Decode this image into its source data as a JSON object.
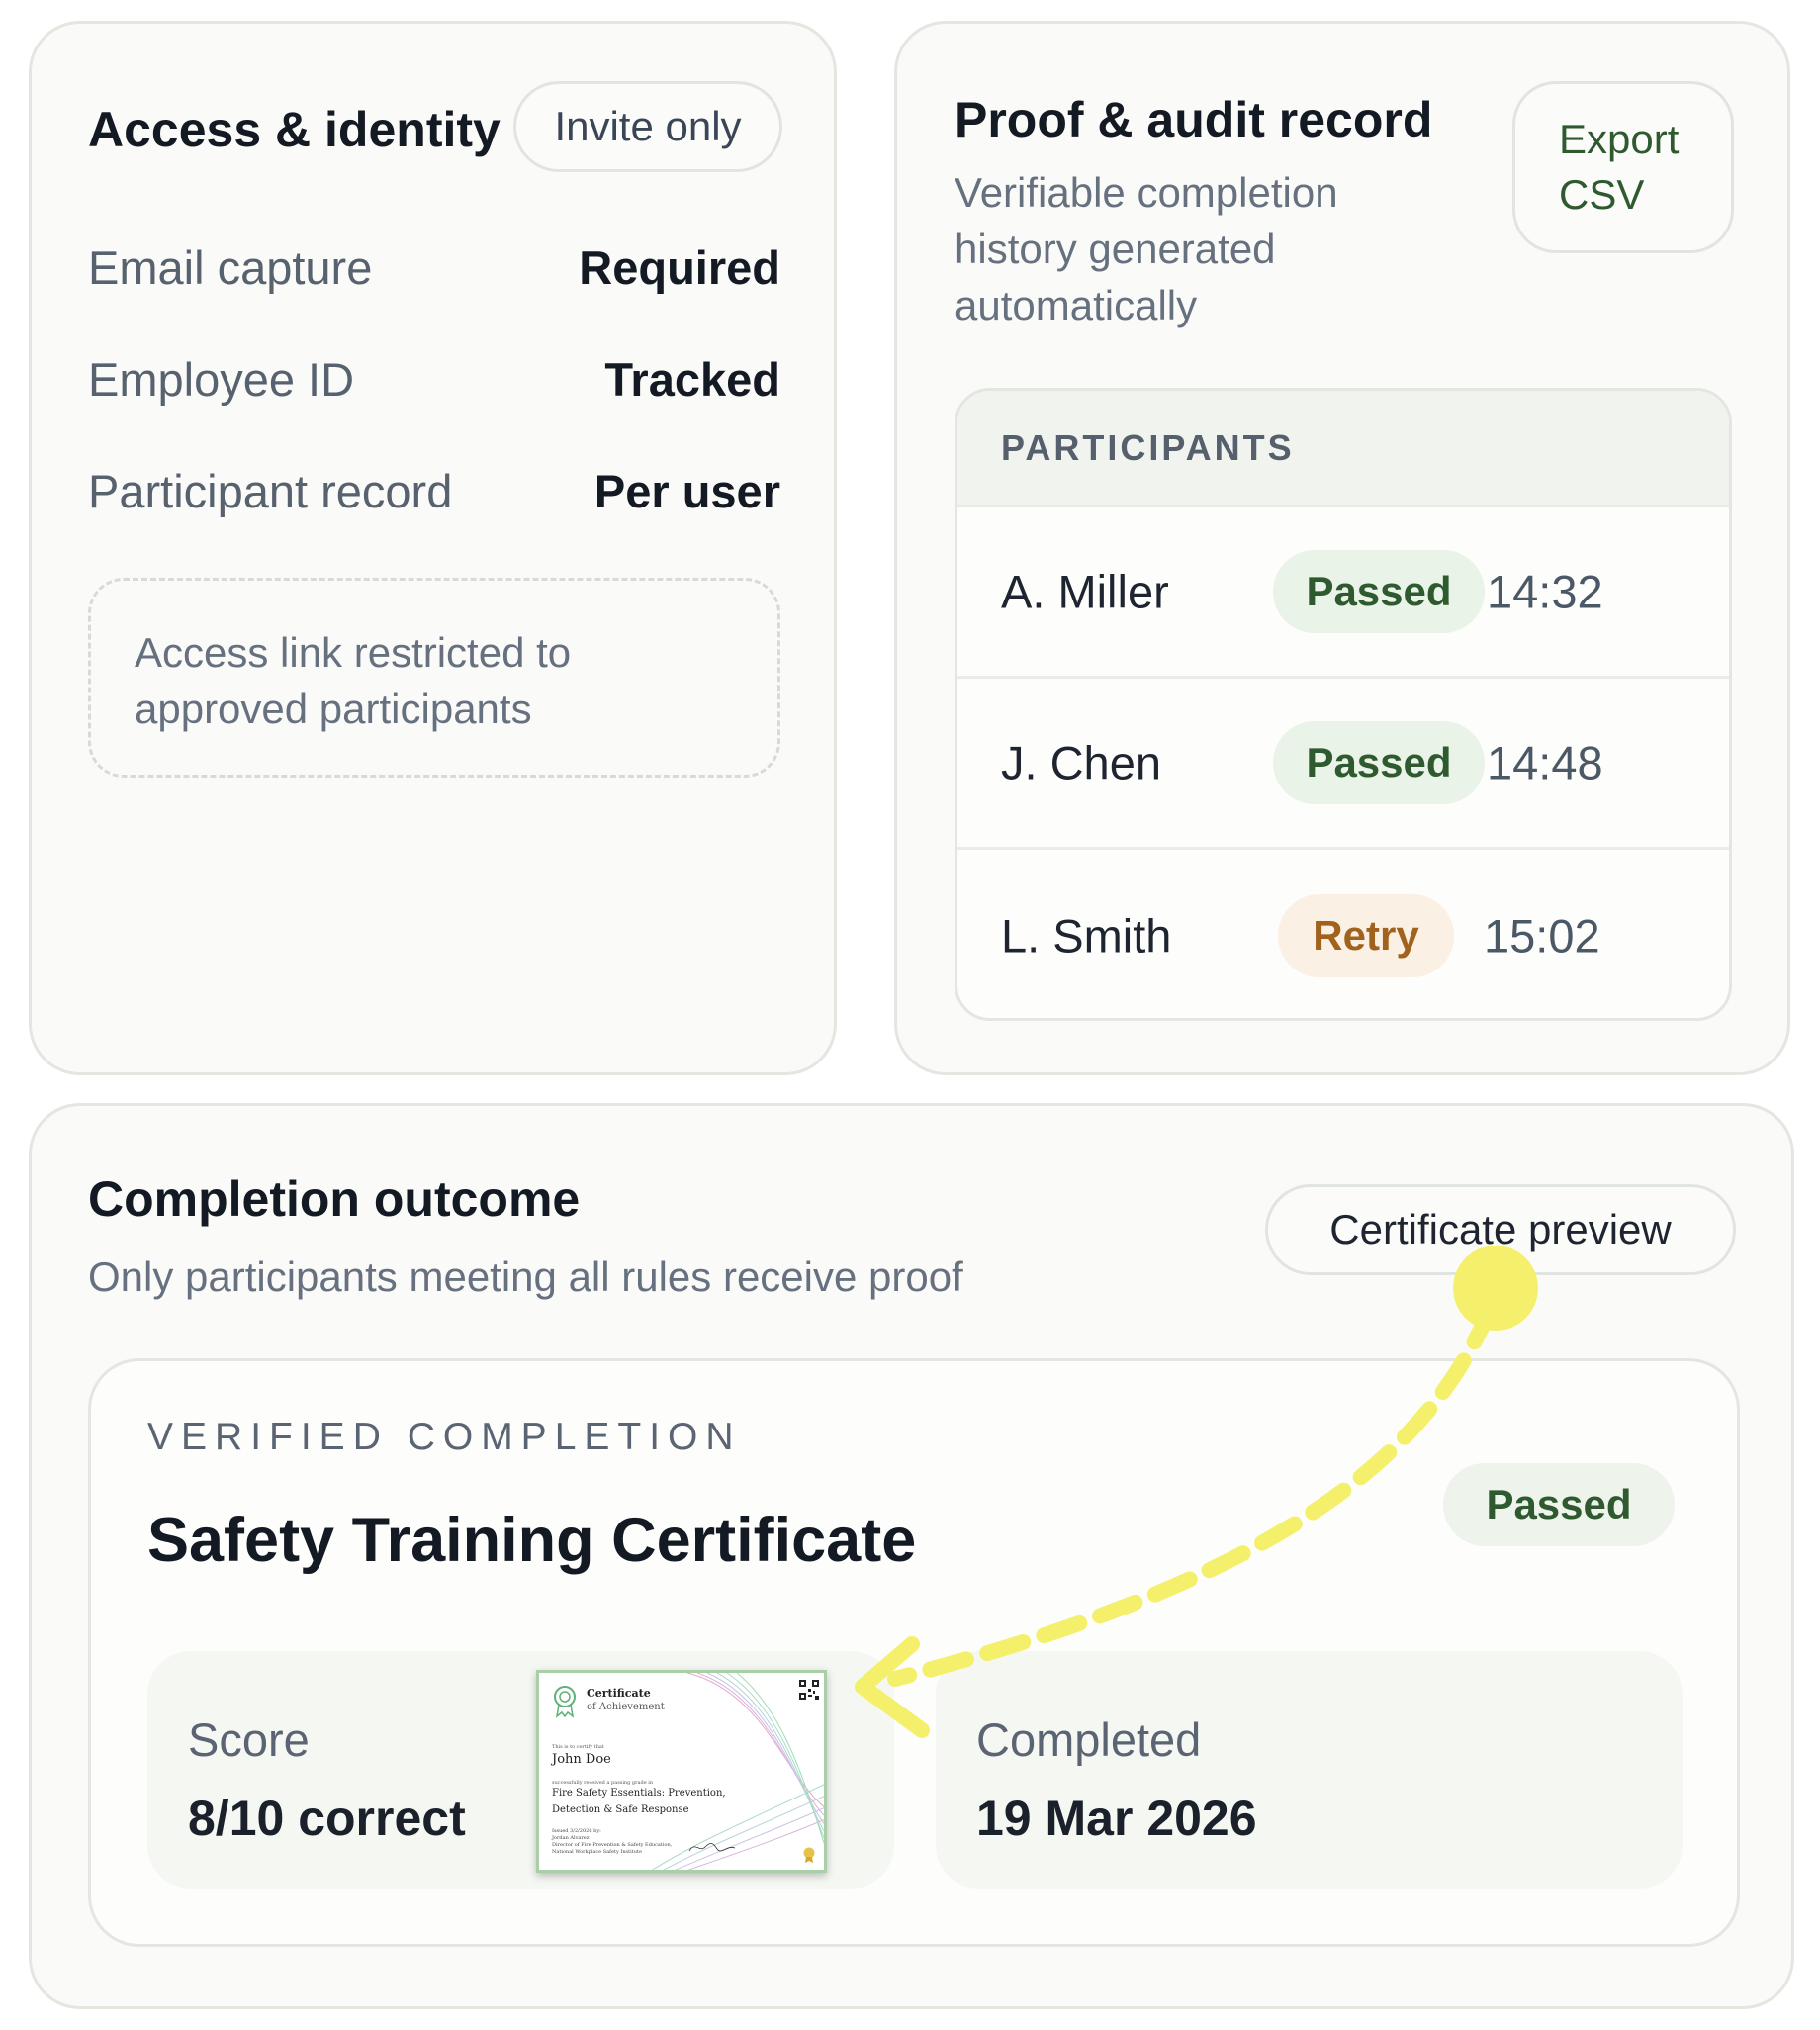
{
  "access": {
    "title": "Access & identity",
    "badge": "Invite only",
    "rows": [
      {
        "label": "Email capture",
        "value": "Required"
      },
      {
        "label": "Employee ID",
        "value": "Tracked"
      },
      {
        "label": "Participant record",
        "value": "Per user"
      }
    ],
    "note": "Access link restricted to approved participants"
  },
  "proof": {
    "title": "Proof & audit record",
    "subtitle": "Verifiable completion history generated automatically",
    "export_label": "Export CSV",
    "table_header": "PARTICIPANTS",
    "participants": [
      {
        "name": "A. Miller",
        "status": "Passed",
        "time": "14:32"
      },
      {
        "name": "J. Chen",
        "status": "Passed",
        "time": "14:48"
      },
      {
        "name": "L. Smith",
        "status": "Retry",
        "time": "15:02"
      }
    ]
  },
  "outcome": {
    "title": "Completion outcome",
    "subtitle": "Only participants meeting all rules receive proof",
    "preview_button": "Certificate preview",
    "eyebrow": "VERIFIED COMPLETION",
    "cert_title": "Safety Training Certificate",
    "badge": "Passed",
    "score_label": "Score",
    "score_value": "8/10 correct",
    "completed_label": "Completed",
    "completed_value": "19 Mar 2026"
  },
  "certificate_thumb": {
    "heading": "Certificate",
    "subheading": "of Achievement",
    "intro": "This is to certify that",
    "recipient": "John Doe",
    "passed_text": "successfully received a passing grade in",
    "course_line1": "Fire Safety Essentials: Prevention,",
    "course_line2": "Detection & Safe Response",
    "issued": "Issued 3/2/2026 by:",
    "issuer_name": "Jordan Alvarez",
    "issuer_title": "Director of Fire Prevention & Safety Education,",
    "issuer_org": "National Workplace Safety Institute"
  },
  "colors": {
    "accent_green": "#2f5a2f",
    "retry_orange": "#a0621c",
    "highlight_yellow": "#f5f06b"
  },
  "icons": [
    "qr-code-icon",
    "ribbon-seal-icon",
    "gold-seal-icon",
    "signature-mark"
  ]
}
